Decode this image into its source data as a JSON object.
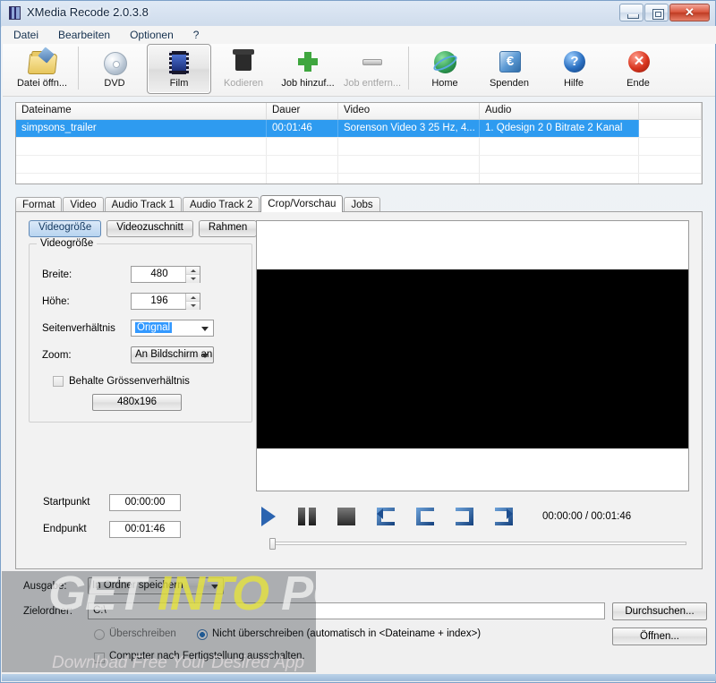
{
  "window": {
    "title": "XMedia Recode 2.0.3.8",
    "icon": "film-strip-icon",
    "buttons": {
      "minimize": "minimize-icon",
      "maximize": "maximize-icon",
      "close": "✕"
    }
  },
  "menu": {
    "items": [
      "Datei",
      "Bearbeiten",
      "Optionen",
      "?"
    ]
  },
  "toolbar": {
    "items": [
      {
        "label": "Datei öffn...",
        "icon": "open-file-icon",
        "state": "normal"
      },
      {
        "label": "DVD",
        "icon": "dvd-disc-icon",
        "state": "normal"
      },
      {
        "label": "Film",
        "icon": "film-icon",
        "state": "selected"
      },
      {
        "label": "Kodieren",
        "icon": "encode-icon",
        "state": "disabled"
      },
      {
        "label": "Job hinzuf...",
        "icon": "plus-icon",
        "state": "normal"
      },
      {
        "label": "Job entfern...",
        "icon": "minus-icon",
        "state": "disabled"
      },
      {
        "label": "Home",
        "icon": "globe-icon",
        "state": "normal"
      },
      {
        "label": "Spenden",
        "icon": "euro-donate-icon",
        "state": "normal"
      },
      {
        "label": "Hilfe",
        "icon": "question-help-icon",
        "state": "normal"
      },
      {
        "label": "Ende",
        "icon": "exit-close-icon",
        "state": "normal"
      }
    ]
  },
  "file_list": {
    "columns": [
      "Dateiname",
      "Dauer",
      "Video",
      "Audio",
      ""
    ],
    "rows": [
      {
        "selected": true,
        "cells": [
          "simpsons_trailer",
          "00:01:46",
          "Sorenson Video 3 25 Hz, 4...",
          "1. Qdesign 2 0 Bitrate 2 Kanal",
          ""
        ]
      }
    ],
    "empty_rows": 3
  },
  "tabs": {
    "items": [
      "Format",
      "Video",
      "Audio Track 1",
      "Audio Track 2",
      "Crop/Vorschau",
      "Jobs"
    ],
    "active": "Crop/Vorschau"
  },
  "crop_panel": {
    "segmented_buttons": [
      {
        "label": "Videogröße",
        "active": true
      },
      {
        "label": "Videozuschnitt",
        "active": false
      },
      {
        "label": "Rahmen",
        "active": false
      }
    ],
    "group_title": "Videogröße",
    "fields": {
      "breite_label": "Breite:",
      "breite_value": "480",
      "hoehe_label": "Höhe:",
      "hoehe_value": "196",
      "aspect_label": "Seitenverhältnis",
      "aspect_value": "Orignal",
      "zoom_label": "Zoom:",
      "zoom_value": "An Bildschirm an",
      "keep_ratio_label": "Behalte Grössenverhältnis",
      "keep_ratio_checked": false,
      "size_button": "480x196"
    },
    "timepoints": {
      "start_label": "Startpunkt",
      "start_value": "00:00:00",
      "end_label": "Endpunkt",
      "end_value": "00:01:46"
    }
  },
  "preview": {
    "controls": [
      {
        "name": "play",
        "icon": "play-icon"
      },
      {
        "name": "pause",
        "icon": "pause-icon"
      },
      {
        "name": "stop",
        "icon": "stop-icon"
      },
      {
        "name": "goto-start",
        "icon": "jump-to-start-icon"
      },
      {
        "name": "set-in",
        "icon": "set-in-point-icon"
      },
      {
        "name": "set-out",
        "icon": "set-out-point-icon"
      },
      {
        "name": "goto-end",
        "icon": "jump-to-end-icon"
      }
    ],
    "time_display": "00:00:00 / 00:01:46",
    "slider_position_percent": 0
  },
  "output": {
    "ausgabe_label": "Ausgabe:",
    "ausgabe_value": "In Ordner speichern",
    "zielordner_label": "Zielordner:",
    "zielordner_value": "C:\\",
    "overwrite_label": "Überschreiben",
    "overwrite_selected": false,
    "no_overwrite_label": "Nicht überschreiben (automatisch in <Dateiname + index>)",
    "no_overwrite_selected": true,
    "shutdown_label": "Computer nach Fertigstellung ausschalten.",
    "shutdown_checked": false,
    "browse_button": "Durchsuchen...",
    "open_button": "Öffnen..."
  },
  "watermark": {
    "part1": "GET",
    "part2": "INTO",
    "part3": "PC",
    "subtitle": "Download Free Your Desired App",
    "color_white": "#f2f2f2",
    "color_yellow": "#e8e53a"
  }
}
